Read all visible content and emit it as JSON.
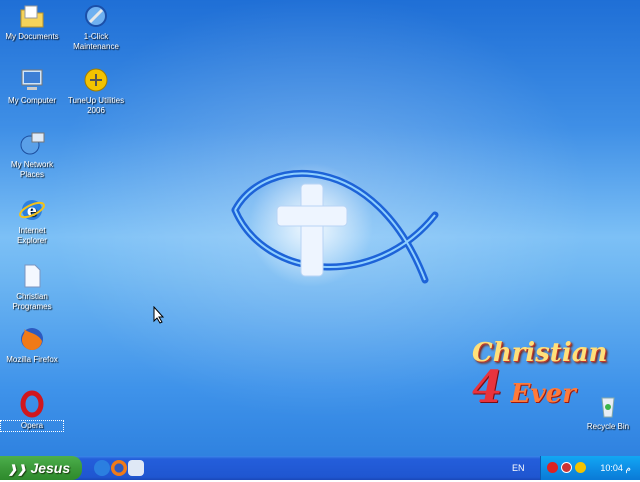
{
  "desktop_icons": [
    {
      "label": "My Documents",
      "icon": "folder-documents-icon"
    },
    {
      "label": "1-Click\nMaintenance",
      "icon": "maintenance-icon"
    },
    {
      "label": "My Computer",
      "icon": "monitor-icon"
    },
    {
      "label": "TuneUp Utilities\n2006",
      "icon": "tuneup-icon"
    },
    {
      "label": "My Network\nPlaces",
      "icon": "network-icon"
    },
    {
      "label": "Internet\nExplorer",
      "icon": "ie-icon"
    },
    {
      "label": "Christian\nProgrames",
      "icon": "document-icon"
    },
    {
      "label": "Mozilla Firefox",
      "icon": "firefox-icon"
    },
    {
      "label": "Opera",
      "icon": "opera-icon"
    },
    {
      "label": "Recycle Bin",
      "icon": "recycle-bin-icon"
    }
  ],
  "branding": {
    "line1": "Christian",
    "four": "4",
    "line2": "Ever"
  },
  "taskbar": {
    "start_label": "Jesus",
    "quicklaunch": [
      "ie-icon",
      "firefox-icon",
      "messenger-icon"
    ],
    "language": "EN",
    "clock": "10:04 م"
  },
  "colors": {
    "taskbar": "#245edb",
    "start": "#3c9a3a",
    "tray": "#0e8fe6"
  }
}
